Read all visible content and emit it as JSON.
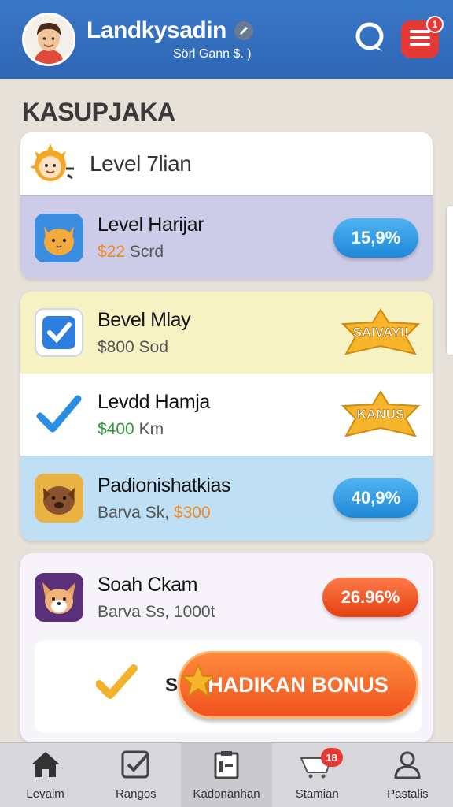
{
  "header": {
    "username": "Landkysadin",
    "subtitle": "Sörl Gann $. )",
    "menu_badge": "1"
  },
  "section_title": "KASUPJAKA",
  "card1": {
    "header_title": "Level 7lian",
    "item": {
      "title": "Level Harijar",
      "price": "$22",
      "price_suffix": "Scrd",
      "pill": "15,9%"
    }
  },
  "card2": {
    "items": [
      {
        "title": "Bevel Mlay",
        "sub": "$800 Sod",
        "badge": "SAIVAYI!"
      },
      {
        "title": "Levdd Hamja",
        "price": "$400",
        "price_suffix": "Km",
        "badge": "KANUS"
      },
      {
        "title": "Padionishatkias",
        "sub_prefix": "Barva Sk,",
        "price": "$300",
        "pill": "40,9%"
      }
    ]
  },
  "card3": {
    "item": {
      "title": "Soah Ckam",
      "sub": "Barva Ss, 1000t",
      "pill": "26.96%"
    },
    "bonus_prefix": "S",
    "bonus_button": "HADIKAN BONUS"
  },
  "nav": {
    "items": [
      {
        "label": "Levalm",
        "icon": "home-icon"
      },
      {
        "label": "Rangos",
        "icon": "checkbox-icon"
      },
      {
        "label": "Kadonanhan",
        "icon": "clipboard-icon"
      },
      {
        "label": "Stamian",
        "icon": "cart-icon",
        "badge": "18"
      },
      {
        "label": "Pastalis",
        "icon": "user-icon"
      }
    ]
  },
  "colors": {
    "header": "#3a78c8",
    "accent_red": "#e53935",
    "pill_blue": "#1e88d8",
    "pill_orange": "#f0521e"
  }
}
